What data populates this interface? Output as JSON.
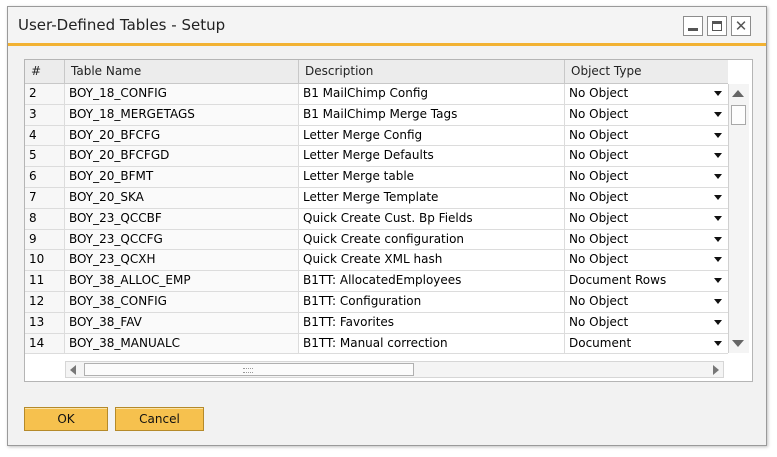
{
  "window": {
    "title": "User-Defined Tables - Setup",
    "controls": {
      "minimize": "minimize-icon",
      "maximize": "maximize-icon",
      "close": "close-icon"
    },
    "accent_color": "#f2b233"
  },
  "table": {
    "columns": [
      "#",
      "Table Name",
      "Description",
      "Object Type"
    ],
    "rows": [
      {
        "num": "2",
        "name": "BOY_18_CONFIG",
        "description": "B1 MailChimp Config",
        "object_type": "No Object"
      },
      {
        "num": "3",
        "name": "BOY_18_MERGETAGS",
        "description": "B1 MailChimp Merge Tags",
        "object_type": "No Object"
      },
      {
        "num": "4",
        "name": "BOY_20_BFCFG",
        "description": "Letter Merge Config",
        "object_type": "No Object"
      },
      {
        "num": "5",
        "name": "BOY_20_BFCFGD",
        "description": "Letter Merge Defaults",
        "object_type": "No Object"
      },
      {
        "num": "6",
        "name": "BOY_20_BFMT",
        "description": "Letter Merge table",
        "object_type": "No Object"
      },
      {
        "num": "7",
        "name": "BOY_20_SKA",
        "description": "Letter Merge Template",
        "object_type": "No Object"
      },
      {
        "num": "8",
        "name": "BOY_23_QCCBF",
        "description": "Quick Create Cust. Bp Fields",
        "object_type": "No Object"
      },
      {
        "num": "9",
        "name": "BOY_23_QCCFG",
        "description": "Quick Create configuration",
        "object_type": "No Object"
      },
      {
        "num": "10",
        "name": "BOY_23_QCXH",
        "description": "Quick Create XML hash",
        "object_type": "No Object"
      },
      {
        "num": "11",
        "name": "BOY_38_ALLOC_EMP",
        "description": "B1TT: AllocatedEmployees",
        "object_type": "Document Rows"
      },
      {
        "num": "12",
        "name": "BOY_38_CONFIG",
        "description": "B1TT: Configuration",
        "object_type": "No Object"
      },
      {
        "num": "13",
        "name": "BOY_38_FAV",
        "description": "B1TT: Favorites",
        "object_type": "No Object"
      },
      {
        "num": "14",
        "name": "BOY_38_MANUALC",
        "description": "B1TT: Manual correction",
        "object_type": "Document"
      }
    ]
  },
  "buttons": {
    "ok": "OK",
    "cancel": "Cancel"
  }
}
